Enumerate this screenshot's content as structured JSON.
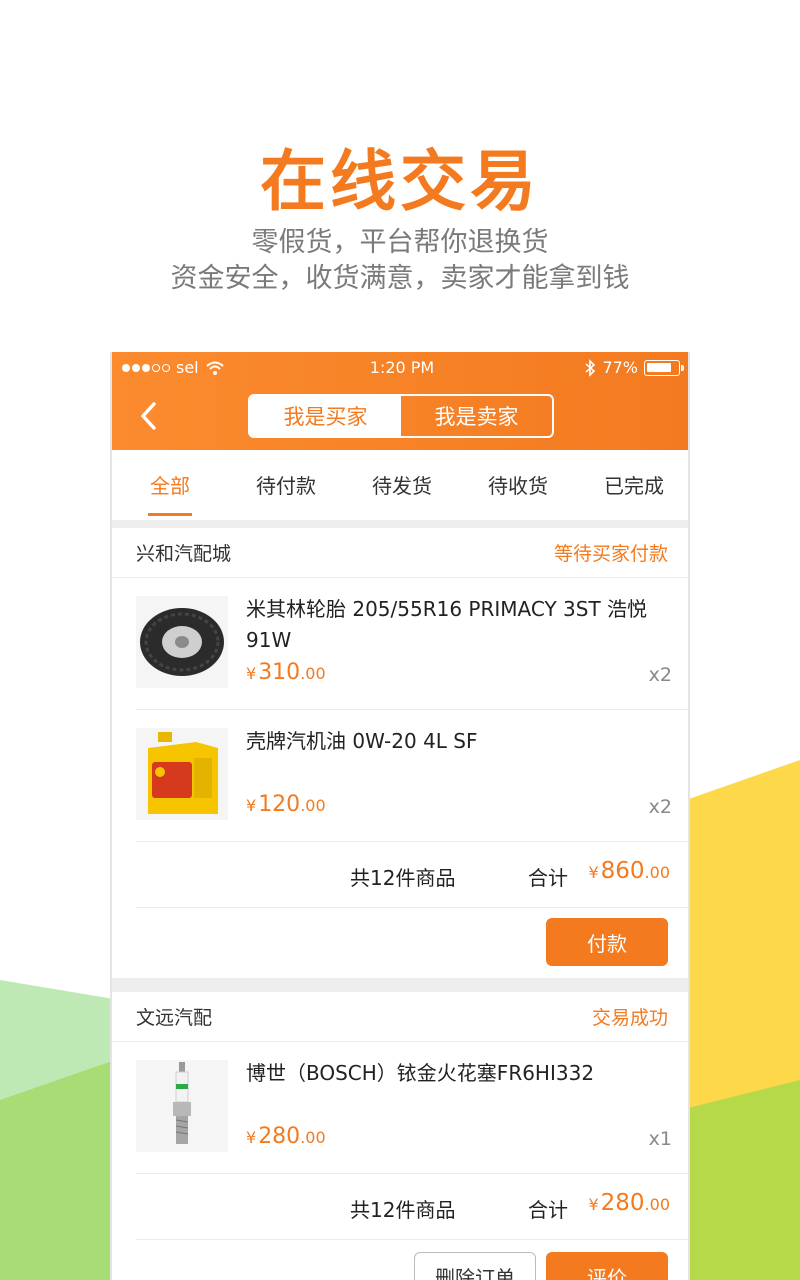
{
  "promo": {
    "title": "在线交易",
    "subtitle1": "零假货，平台帮你退换货",
    "subtitle2": "资金安全，收货满意，卖家才能拿到钱"
  },
  "status_bar": {
    "carrier": "sel",
    "time": "1:20 PM",
    "battery": "77%"
  },
  "header": {
    "back_icon": "chevron-left-icon",
    "segment": {
      "buyer_label": "我是买家",
      "seller_label": "我是卖家",
      "selected": "buyer"
    }
  },
  "tabs": [
    "全部",
    "待付款",
    "待发货",
    "待收货",
    "已完成"
  ],
  "orders": [
    {
      "store": "兴和汽配城",
      "status": "等待买家付款",
      "items": [
        {
          "title": "米其林轮胎 205/55R16 PRIMACY 3ST 浩悦 91W",
          "currency": "¥",
          "price_int": "310",
          "price_dec": ".00",
          "qty": "x2"
        },
        {
          "title": "壳牌汽机油 0W-20 4L SF",
          "currency": "¥",
          "price_int": "120",
          "price_dec": ".00",
          "qty": "x2"
        }
      ],
      "count_text": "共12件商品",
      "total_label": "合计",
      "total_currency": "¥",
      "total_int": "860",
      "total_dec": ".00",
      "pay_label": "付款"
    },
    {
      "store": "文远汽配",
      "status": "交易成功",
      "items": [
        {
          "title": "博世（BOSCH）铱金火花塞FR6HI332",
          "currency": "¥",
          "price_int": "280",
          "price_dec": ".00",
          "qty": "x1"
        }
      ],
      "count_text": "共12件商品",
      "total_label": "合计",
      "total_currency": "¥",
      "total_int": "280",
      "total_dec": ".00",
      "delete_label": "删除订单",
      "review_label": "评价"
    }
  ],
  "colors": {
    "accent": "#f47a20",
    "bg_yellow": "#fdd84a",
    "bg_green": "#a8e08a"
  }
}
